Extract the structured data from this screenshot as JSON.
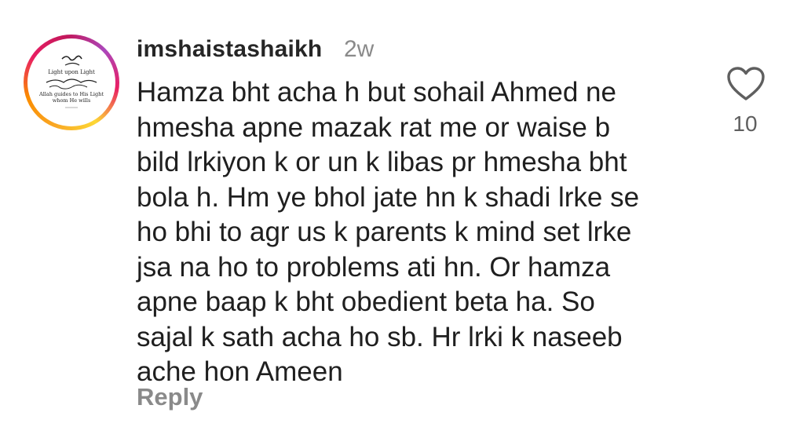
{
  "comment": {
    "username": "imshaistashaikh",
    "time_ago": "2w",
    "text_lines": [
      "Hamza bht acha h but sohail Ahmed ne",
      "hmesha apne mazak rat me or waise b",
      "bild lrkiyon k or un k libas pr hmesha bht",
      "bola h. Hm ye bhol jate hn k shadi lrke se",
      "ho bhi to agr us k parents k mind set lrke",
      "jsa na ho to problems ati hn. Or hamza",
      "apne baap k bht obedient beta ha. So",
      "sajal k sath acha ho sb. Hr lrki k naseeb",
      "ache hon Ameen"
    ],
    "reply_label": "Reply",
    "like_count": "10",
    "like_icon": "heart-outline-icon"
  },
  "avatar": {
    "icon": "avatar-logo",
    "text_line1": "Light upon Light",
    "text_line2": "Allah guides to His Light",
    "text_line3": "whom He wills"
  },
  "colors": {
    "username": "#262626",
    "muted": "#8a8a8a",
    "text": "#1f1f1f",
    "ring_start": "#f9a825",
    "ring_end": "#c2185b"
  }
}
